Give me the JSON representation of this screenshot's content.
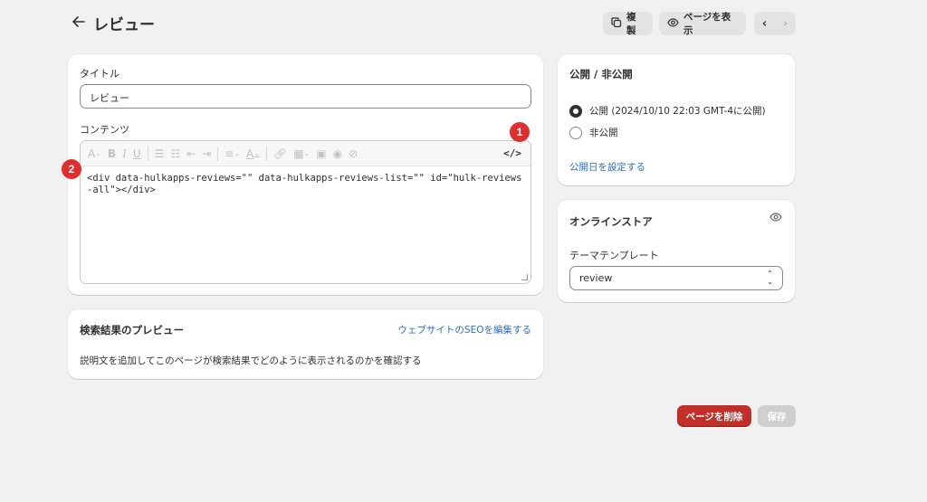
{
  "header": {
    "title": "レビュー",
    "duplicate_label": "複製",
    "view_page_label": "ページを表示"
  },
  "content_card": {
    "title_label": "タイトル",
    "title_value": "レビュー",
    "content_label": "コンテンツ",
    "code_toggle_label": "</>",
    "code": "<div data-hulkapps-reviews=\"\" data-hulkapps-reviews-list=\"\" id=\"hulk-reviews-all\"></div>"
  },
  "markers": {
    "one": "1",
    "two": "2"
  },
  "seo_card": {
    "title": "検索結果のプレビュー",
    "edit_link": "ウェブサイトのSEOを編集する",
    "description": "説明文を追加してこのページが検索結果でどのように表示されるのかを確認する"
  },
  "visibility_card": {
    "title": "公開 / 非公開",
    "options": [
      {
        "label": "公開 (2024/10/10 22:03 GMT-4に公開)",
        "selected": true
      },
      {
        "label": "非公開",
        "selected": false
      }
    ],
    "set_date_link": "公開日を設定する"
  },
  "store_card": {
    "title": "オンラインストア",
    "template_label": "テーマテンプレート",
    "template_value": "review"
  },
  "footer": {
    "delete_label": "ページを削除",
    "save_label": "保存"
  },
  "colors": {
    "accent_link": "#2c6ecb",
    "danger": "#c22f29",
    "marker": "#e02d2d"
  },
  "icons": [
    "back-arrow-icon",
    "duplicate-icon",
    "eye-icon",
    "chevron-left-icon",
    "chevron-right-icon"
  ]
}
